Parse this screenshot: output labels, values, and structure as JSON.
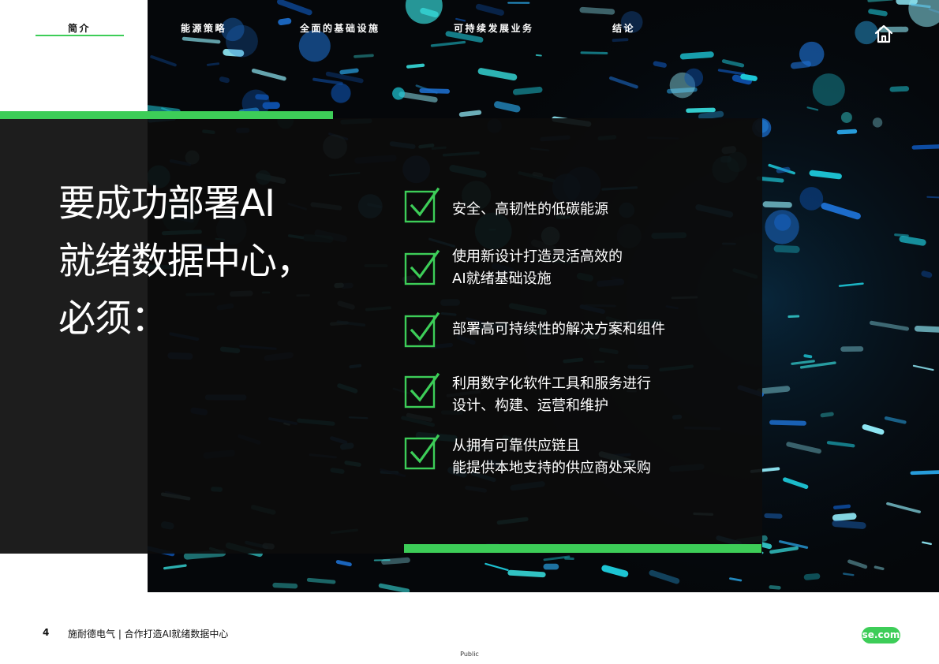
{
  "nav": {
    "items": [
      {
        "label": "简介",
        "active": true
      },
      {
        "label": "能源策略",
        "active": false
      },
      {
        "label": "全面的基础设施",
        "active": false
      },
      {
        "label": "可持续发展业务",
        "active": false
      },
      {
        "label": "结论",
        "active": false
      }
    ],
    "home_icon": "home-icon"
  },
  "headline": {
    "line1": "要成功部署AI",
    "line2": "就绪数据中心，",
    "line3": "必须："
  },
  "requirements": [
    {
      "lines": [
        "安全、高韧性的低碳能源"
      ]
    },
    {
      "lines": [
        "使用新设计打造灵活高效的",
        "AI就绪基础设施"
      ]
    },
    {
      "lines": [
        "部署高可持续性的解决方案和组件"
      ]
    },
    {
      "lines": [
        "利用数字化软件工具和服务进行",
        "设计、构建、运营和维护"
      ]
    },
    {
      "lines": [
        "从拥有可靠供应链且",
        "能提供本地支持的供应商处采购"
      ]
    }
  ],
  "footer": {
    "page_number": "4",
    "text": "施耐德电气 | 合作打造AI就绪数据中心",
    "site": "se.com",
    "classification": "Public"
  },
  "colors": {
    "accent_green": "#3dcd58",
    "panel": "#0c0c0c"
  }
}
